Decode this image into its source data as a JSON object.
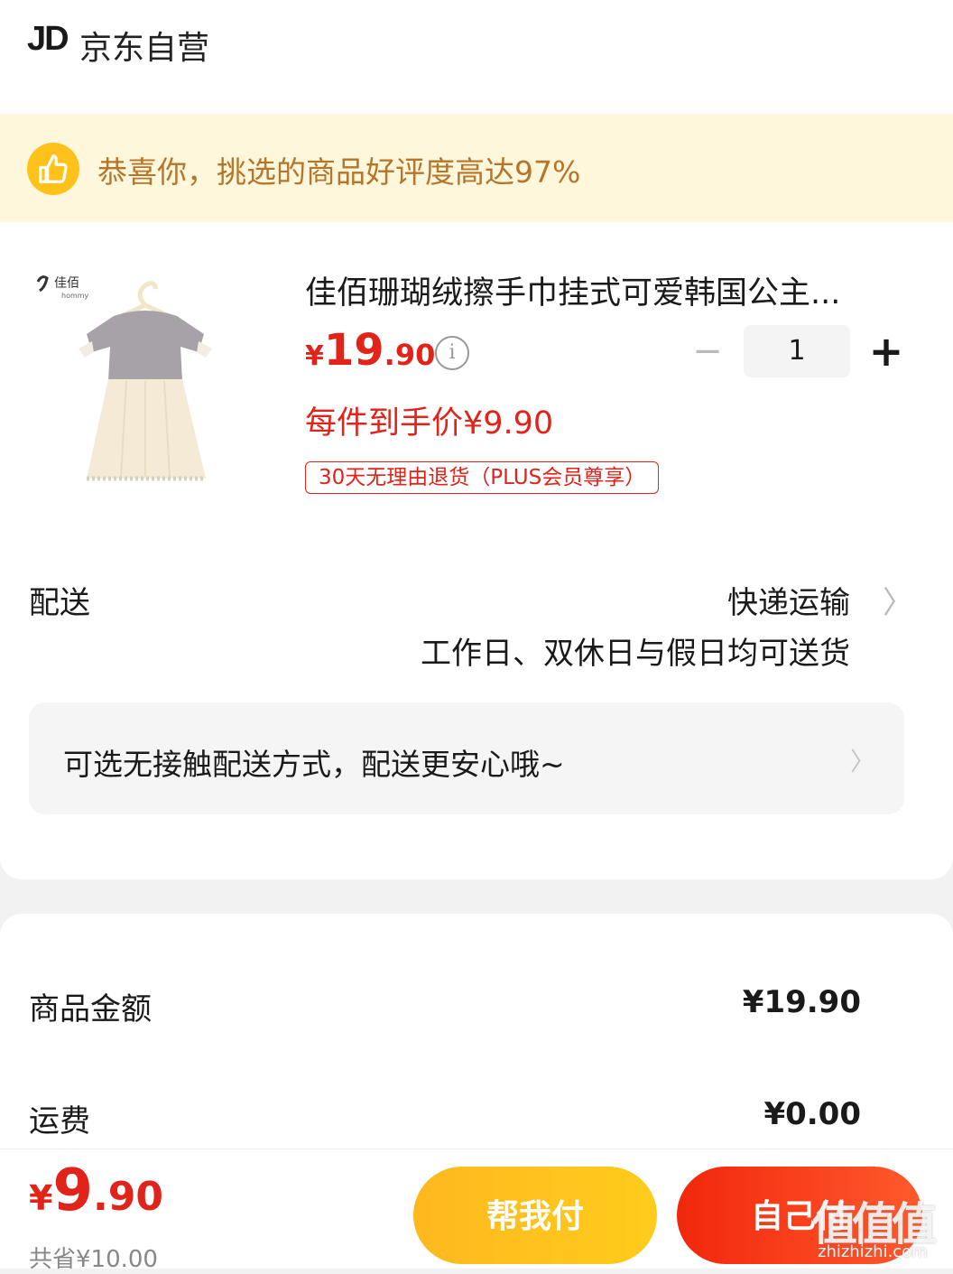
{
  "header": {
    "logo": "JD",
    "store": "京东自营"
  },
  "banner": {
    "icon": "thumbs-up-icon",
    "text": "恭喜你，挑选的商品好评度高达97%"
  },
  "product": {
    "brand_logo": "佳佰",
    "brand_logo_sub": "hommy",
    "title": "佳佰珊瑚绒擦手巾挂式可爱韩国公主...",
    "price_currency": "¥",
    "price_int": "19",
    "price_dec": ".90",
    "quantity": "1",
    "hand_price": "每件到手价¥9.90",
    "return_tag": "30天无理由退货（PLUS会员尊享）"
  },
  "delivery": {
    "label": "配送",
    "method": "快递运输",
    "time": "工作日、双休日与假日均可送货",
    "contactless": "可选无接触配送方式，配送更安心哦~"
  },
  "summary": {
    "goods_label": "商品金额",
    "goods_value": "¥19.90",
    "shipping_label": "运费",
    "shipping_value": "¥0.00"
  },
  "bottom": {
    "currency": "¥",
    "total_int": "9",
    "total_dec": ".90",
    "saved": "共省¥10.00",
    "help_pay": "帮我付",
    "self_pay": "自己付"
  },
  "watermark": {
    "main": "值值值",
    "sub": "zhizhizhi.com"
  },
  "colors": {
    "accent_red": "#e2231a",
    "banner_bg": "#fff7dc",
    "banner_text": "#b5752a",
    "help_pay": "#ffc21a",
    "self_pay": "#f2270c"
  }
}
